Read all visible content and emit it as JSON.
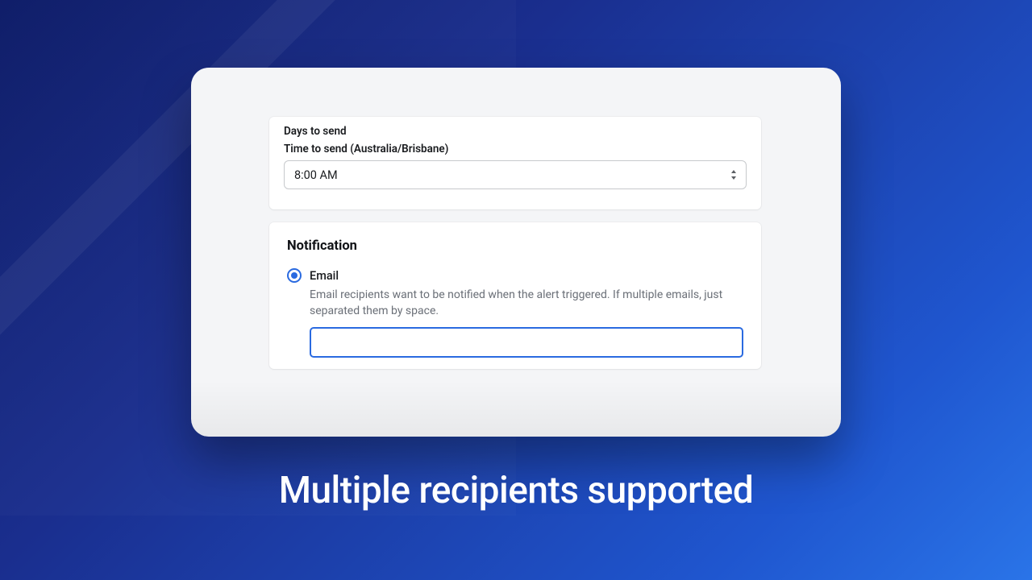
{
  "headline": "Multiple recipients supported",
  "schedule": {
    "days_label": "Days to send",
    "time_label": "Time to send (Australia/Brisbane)",
    "time_value": "8:00 AM"
  },
  "notification": {
    "title": "Notification",
    "option_label": "Email",
    "help": "Email recipients want to be notified when the alert triggered. If multiple emails, just separated them by space.",
    "input_value": ""
  },
  "colors": {
    "accent": "#2a6ae0"
  }
}
